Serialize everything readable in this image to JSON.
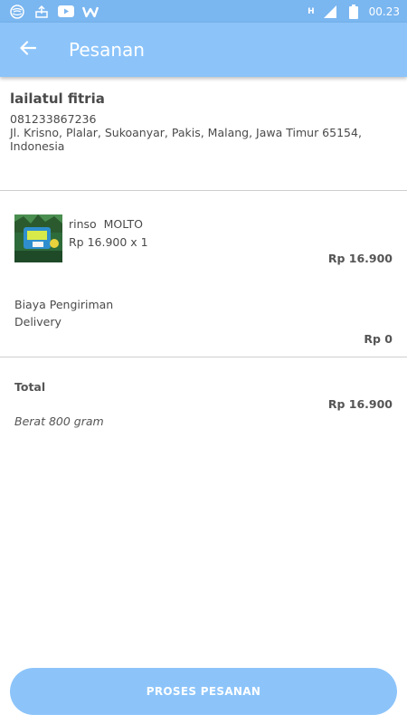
{
  "status_bar": {
    "time": "00.23",
    "network": "H",
    "icons": [
      "globe-icon",
      "cloud-upload-icon",
      "youtube-icon",
      "w-app-icon",
      "signal-icon",
      "battery-icon"
    ]
  },
  "app_bar": {
    "title": "Pesanan",
    "back_icon": "arrow-left-icon"
  },
  "address": {
    "name": "lailatul fitria",
    "phone": "081233867236",
    "line1": "Jl. Krisno, Plalar, Sukoanyar, Pakis, Malang, Jawa Timur 65154,",
    "line2": "Indonesia"
  },
  "product": {
    "name": "rinso  MOLTO",
    "price_qty": "Rp 16.900 x 1",
    "subtotal": "Rp 16.900"
  },
  "shipping": {
    "label": "Biaya Pengiriman",
    "method": "Delivery",
    "cost": "Rp 0"
  },
  "total": {
    "label": "Total",
    "value": "Rp 16.900",
    "weight": "Berat 800 gram"
  },
  "button": {
    "label": "PROSES PESANAN"
  },
  "colors": {
    "status_bar": "#7ab6f0",
    "app_bar": "#8cc4fa",
    "button": "#8cc4fa"
  }
}
